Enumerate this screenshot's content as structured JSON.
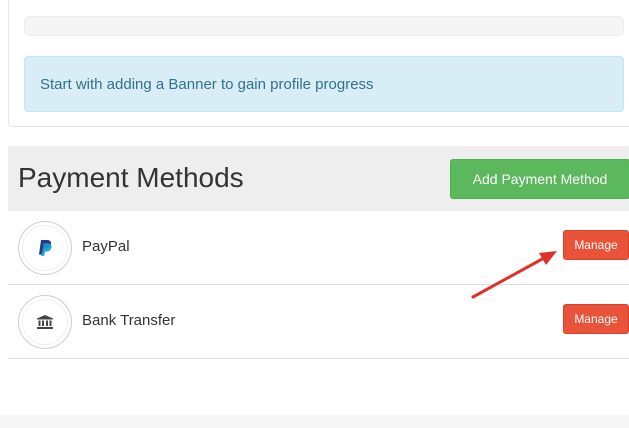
{
  "profile": {
    "progress_percent": 0,
    "alert_text": "Start with adding a Banner to gain profile progress"
  },
  "payment_methods": {
    "title": "Payment Methods",
    "add_button_label": "Add Payment Method",
    "items": [
      {
        "label": "PayPal",
        "icon": "paypal-icon",
        "manage_label": "Manage"
      },
      {
        "label": "Bank Transfer",
        "icon": "bank-icon",
        "manage_label": "Manage"
      }
    ]
  },
  "colors": {
    "success": "#5cb85c",
    "danger": "#e9533a",
    "info_bg": "#d9edf7",
    "info_text": "#31708f",
    "annotation_arrow": "#e0302a",
    "paypal_dark": "#253b80",
    "paypal_light": "#179bd7"
  }
}
